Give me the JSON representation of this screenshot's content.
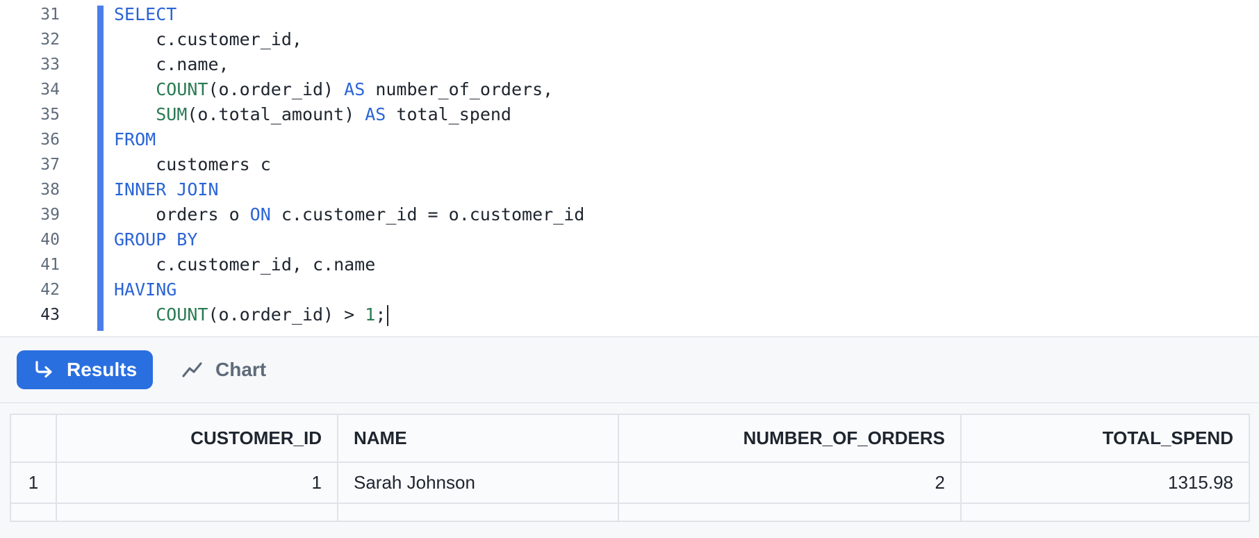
{
  "editor": {
    "lines": [
      {
        "num": "31",
        "tokens": [
          {
            "t": "SELECT",
            "c": "kw"
          }
        ]
      },
      {
        "num": "32",
        "tokens": [
          {
            "t": "    c.customer_id,",
            "c": "pl"
          }
        ]
      },
      {
        "num": "33",
        "tokens": [
          {
            "t": "    c.name,",
            "c": "pl"
          }
        ]
      },
      {
        "num": "34",
        "tokens": [
          {
            "t": "    ",
            "c": "pl"
          },
          {
            "t": "COUNT",
            "c": "fn"
          },
          {
            "t": "(o.order_id) ",
            "c": "pl"
          },
          {
            "t": "AS",
            "c": "kw"
          },
          {
            "t": " number_of_orders,",
            "c": "pl"
          }
        ]
      },
      {
        "num": "35",
        "tokens": [
          {
            "t": "    ",
            "c": "pl"
          },
          {
            "t": "SUM",
            "c": "fn"
          },
          {
            "t": "(o.total_amount) ",
            "c": "pl"
          },
          {
            "t": "AS",
            "c": "kw"
          },
          {
            "t": " total_spend",
            "c": "pl"
          }
        ]
      },
      {
        "num": "36",
        "tokens": [
          {
            "t": "FROM",
            "c": "kw"
          }
        ]
      },
      {
        "num": "37",
        "tokens": [
          {
            "t": "    customers c",
            "c": "pl"
          }
        ]
      },
      {
        "num": "38",
        "tokens": [
          {
            "t": "INNER JOIN",
            "c": "kw"
          }
        ]
      },
      {
        "num": "39",
        "tokens": [
          {
            "t": "    orders o ",
            "c": "pl"
          },
          {
            "t": "ON",
            "c": "kw"
          },
          {
            "t": " c.customer_id = o.customer_id",
            "c": "pl"
          }
        ]
      },
      {
        "num": "40",
        "tokens": [
          {
            "t": "GROUP BY",
            "c": "kw"
          }
        ]
      },
      {
        "num": "41",
        "tokens": [
          {
            "t": "    c.customer_id, c.name",
            "c": "pl"
          }
        ]
      },
      {
        "num": "42",
        "tokens": [
          {
            "t": "HAVING",
            "c": "kw"
          }
        ]
      },
      {
        "num": "43",
        "tokens": [
          {
            "t": "    ",
            "c": "pl"
          },
          {
            "t": "COUNT",
            "c": "fn"
          },
          {
            "t": "(o.order_id) > ",
            "c": "pl"
          },
          {
            "t": "1",
            "c": "num"
          },
          {
            "t": ";",
            "c": "pl"
          }
        ],
        "active": true,
        "caret": true
      }
    ]
  },
  "toolbar": {
    "results_label": "Results",
    "results_icon": "return-arrow-icon",
    "chart_label": "Chart",
    "chart_icon": "line-chart-icon"
  },
  "results": {
    "columns": [
      "CUSTOMER_ID",
      "NAME",
      "NUMBER_OF_ORDERS",
      "TOTAL_SPEND"
    ],
    "rows": [
      {
        "row_num": "1",
        "customer_id": "1",
        "name": "Sarah Johnson",
        "number_of_orders": "2",
        "total_spend": "1315.98"
      }
    ]
  },
  "colors": {
    "keyword": "#2a64d6",
    "function": "#2a7a53",
    "accent": "#2a6fe0",
    "change_bar": "#4a7ee8"
  }
}
